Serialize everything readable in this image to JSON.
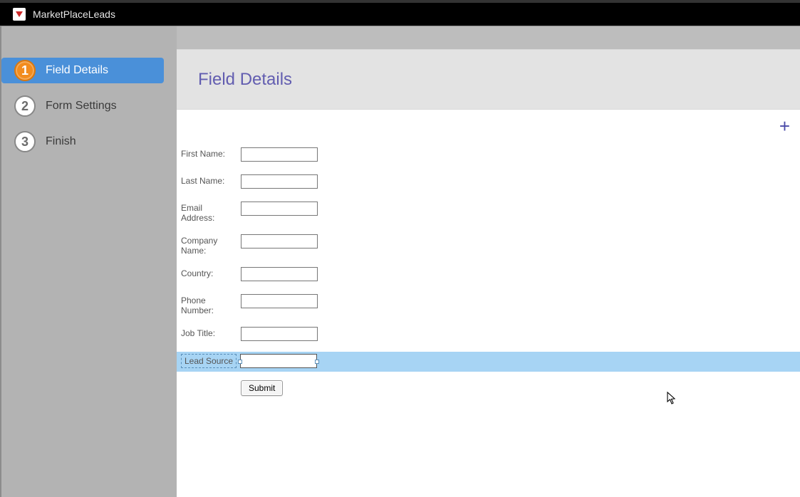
{
  "header": {
    "app_title": "MarketPlaceLeads"
  },
  "sidebar": {
    "steps": [
      {
        "num": "1",
        "label": "Field Details",
        "active": true
      },
      {
        "num": "2",
        "label": "Form Settings",
        "active": false
      },
      {
        "num": "3",
        "label": "Finish",
        "active": false
      }
    ]
  },
  "main": {
    "panel_title": "Field Details",
    "add_icon_glyph": "+"
  },
  "form": {
    "fields": [
      {
        "label": "First Name:",
        "value": ""
      },
      {
        "label": "Last Name:",
        "value": ""
      },
      {
        "label": "Email Address:",
        "value": ""
      },
      {
        "label": "Company Name:",
        "value": ""
      },
      {
        "label": "Country:",
        "value": ""
      },
      {
        "label": "Phone Number:",
        "value": ""
      },
      {
        "label": "Job Title:",
        "value": ""
      }
    ],
    "selected_field": {
      "label": "Lead Source",
      "value": ""
    },
    "submit_label": "Submit"
  }
}
